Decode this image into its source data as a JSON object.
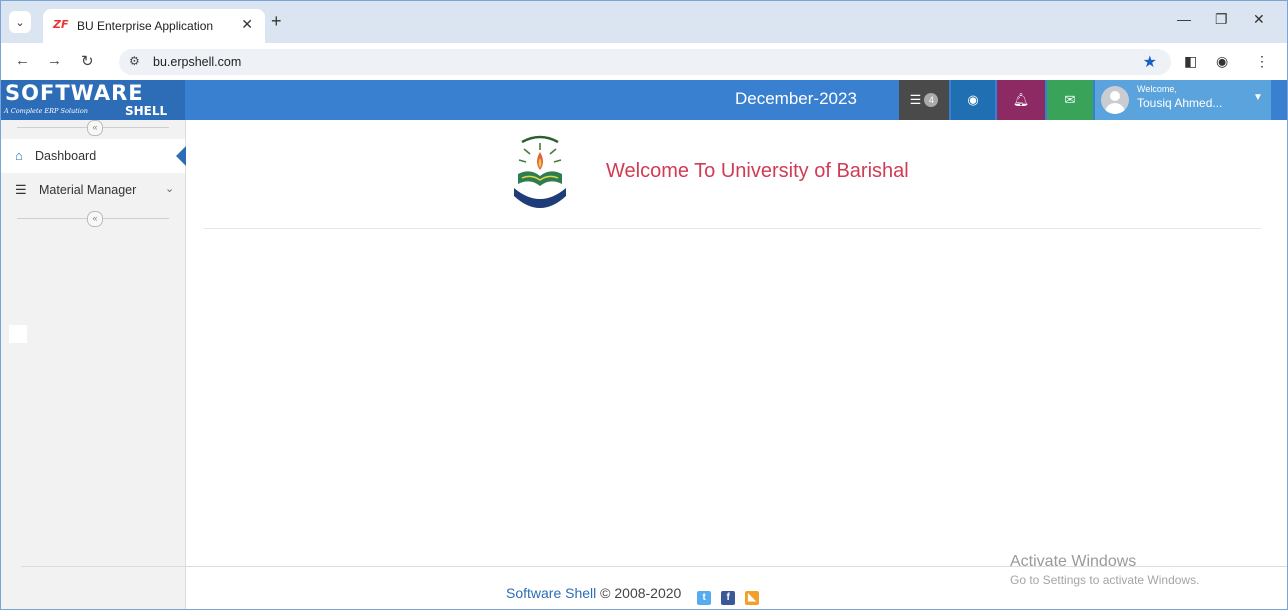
{
  "browser": {
    "tab_title": "BU Enterprise Application",
    "tab_favicon_text": "ZF",
    "url": "bu.erpshell.com"
  },
  "header": {
    "logo_text": "SOFTWARE",
    "logo_subtitle": "A Complete ERP Solution",
    "logo_shell": "SHELL",
    "period": "December-2023",
    "tasks_badge": "4",
    "welcome_label": "Welcome,",
    "user_name": "Tousiq Ahmed...",
    "colors": {
      "header_bg": "#3981d0",
      "tasks_btn": "#4a4a4a",
      "view_btn": "#1f6fb2",
      "notify_btn": "#8e2a63",
      "mail_btn": "#3aa35a"
    }
  },
  "sidebar": {
    "items": [
      {
        "label": "Dashboard",
        "icon": "home-icon",
        "active": true
      },
      {
        "label": "Material Manager",
        "icon": "list-icon",
        "expandable": true
      }
    ]
  },
  "main": {
    "welcome_text": "Welcome To University of Barishal"
  },
  "footer": {
    "brand": "Software Shell",
    "copyright": "© 2008-2020"
  },
  "watermark": {
    "title": "Activate Windows",
    "subtitle": "Go to Settings to activate Windows."
  }
}
